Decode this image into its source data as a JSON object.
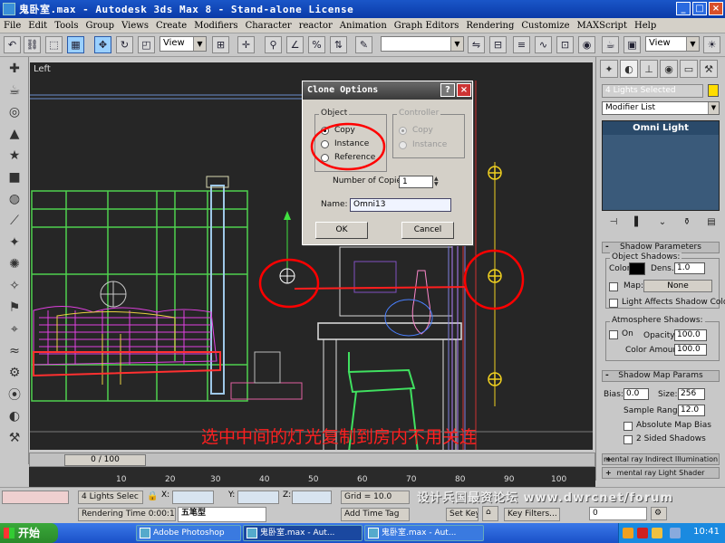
{
  "window": {
    "title": "鬼卧室.max - Autodesk 3ds Max 8  - Stand-alone License",
    "min": "_",
    "max": "□",
    "close": "×"
  },
  "menu": [
    "File",
    "Edit",
    "Tools",
    "Group",
    "Views",
    "Create",
    "Modifiers",
    "Character",
    "reactor",
    "Animation",
    "Graph Editors",
    "Rendering",
    "Customize",
    "MAXScript",
    "Help"
  ],
  "toolbar": {
    "view_dropdown_1": "View",
    "named_selection": "",
    "view_dropdown_2": "View"
  },
  "viewport": {
    "label": "Left"
  },
  "caption": "选中中间的灯光复制到房内不用关连",
  "dialog": {
    "title": "Clone Options",
    "help": "?",
    "close": "×",
    "object_group": "Object",
    "copy": "Copy",
    "instance": "Instance",
    "reference": "Reference",
    "controller_group": "Controller",
    "ctrl_copy": "Copy",
    "ctrl_instance": "Instance",
    "copies_label": "Number of Copies:",
    "copies_value": "1",
    "name_label": "Name:",
    "name_value": "Omni13",
    "ok": "OK",
    "cancel": "Cancel"
  },
  "panel": {
    "selection": "4 Lights Selected",
    "selection_color": "#ffdd00",
    "modifier_list": "Modifier List",
    "stack_item": "Omni Light",
    "shadow_params_header": "Shadow Parameters",
    "object_shadows": "Object Shadows:",
    "color_label": "Color:",
    "dens_label": "Dens.",
    "dens_value": "1.0",
    "map_label": "Map:",
    "map_button": "None",
    "light_affects": "Light Affects Shadow Color",
    "atmo_shadows": "Atmosphere Shadows:",
    "on_label": "On",
    "opacity_label": "Opacity:",
    "opacity_value": "100.0",
    "color_amount_label": "Color Amount:",
    "color_amount_value": "100.0",
    "shadow_map_header": "Shadow Map Params",
    "bias_label": "Bias:",
    "bias_value": "0.0",
    "size_label": "Size:",
    "size_value": "256",
    "sample_label": "Sample Range:",
    "sample_value": "12.0",
    "absolute_bias": "Absolute Map Bias",
    "two_sided": "2 Sided Shadows",
    "mr_indirect": "mental ray Indirect Illumination",
    "mr_shader": "mental ray Light Shader"
  },
  "timeline": {
    "slider": "0 / 100",
    "ticks": [
      "10",
      "20",
      "30",
      "40",
      "50",
      "60",
      "70",
      "80",
      "90",
      "100"
    ]
  },
  "status": {
    "selected": "4 Lights Selec",
    "x_label": "X:",
    "y_label": "Y:",
    "z_label": "Z:",
    "grid": "Grid = 10.0",
    "rendering_time": "Rendering Time  0:00:13",
    "ime": "五笔型",
    "add_time_tag": "Add Time Tag",
    "set_key": "Set Key",
    "key_filters": "Key Filters...",
    "frame": "0",
    "watermark": "设计兵国最资论坛 www.dwrcnet/forum"
  },
  "taskbar": {
    "start": "开始",
    "tasks": [
      "Adobe Photoshop",
      "鬼卧室.max - Aut...",
      "鬼卧室.max - Aut..."
    ],
    "clock": "10:41"
  }
}
